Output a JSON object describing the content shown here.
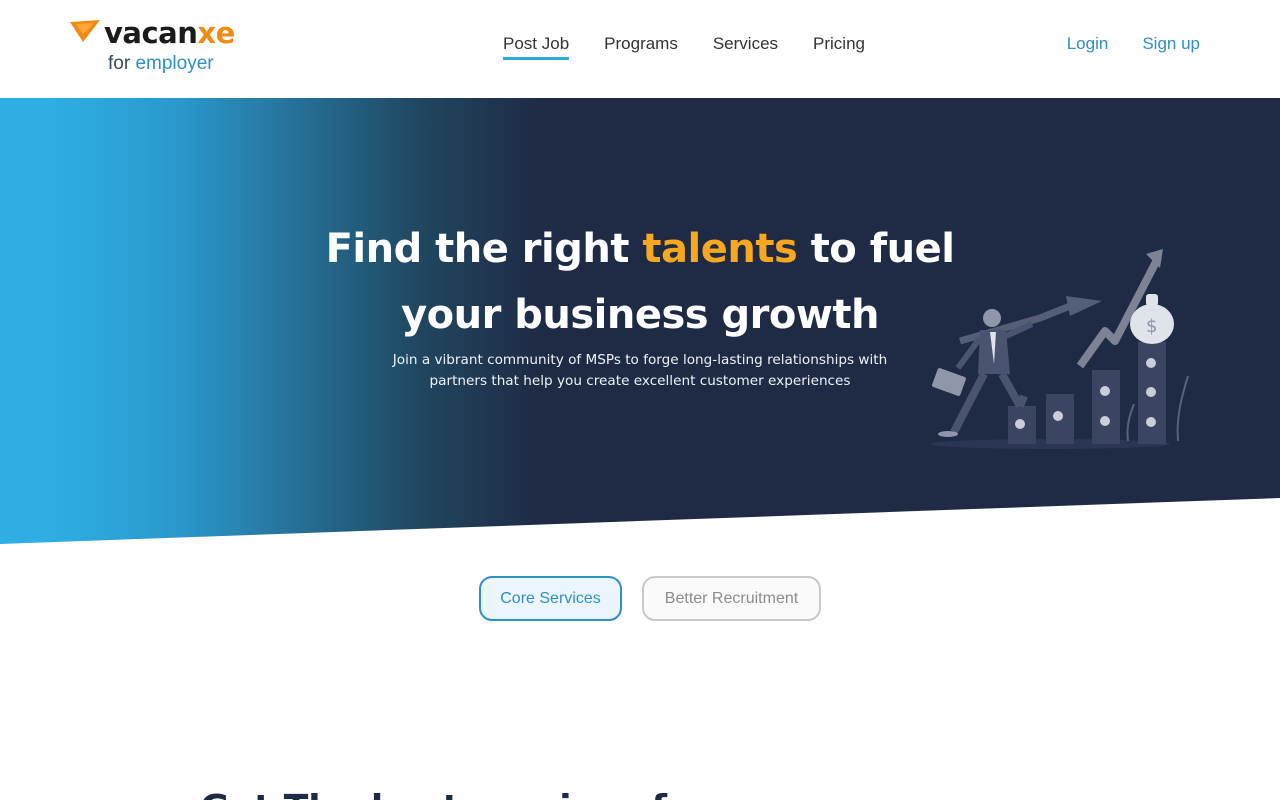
{
  "brand": {
    "name_part1": "vacan",
    "name_part2": "xe",
    "sub_prefix": "for",
    "sub_highlight": "employer",
    "colors": {
      "orange": "#f08a12",
      "blue": "#2f8fc6",
      "navy": "#1f2a44"
    }
  },
  "nav": {
    "items": [
      {
        "label": "Post Job",
        "active": true
      },
      {
        "label": "Programs"
      },
      {
        "label": "Services"
      },
      {
        "label": "Pricing"
      }
    ]
  },
  "auth": {
    "login": "Login",
    "signup": "Sign up"
  },
  "hero": {
    "title_part1": "Find the right",
    "title_highlight": "talents",
    "title_part2": "to fuel",
    "title_line2": "your business growth",
    "subtitle_line1": "Join a vibrant community of MSPs to forge long-lasting relationships with",
    "subtitle_line2": "partners that help you create excellent customer experiences",
    "illustration": "business-growth-illustration"
  },
  "tabs": [
    {
      "label": "Core Services",
      "active": true
    },
    {
      "label": "Better Recruitment",
      "active": false
    }
  ],
  "section": {
    "heading_partial": "Get The best services for"
  }
}
